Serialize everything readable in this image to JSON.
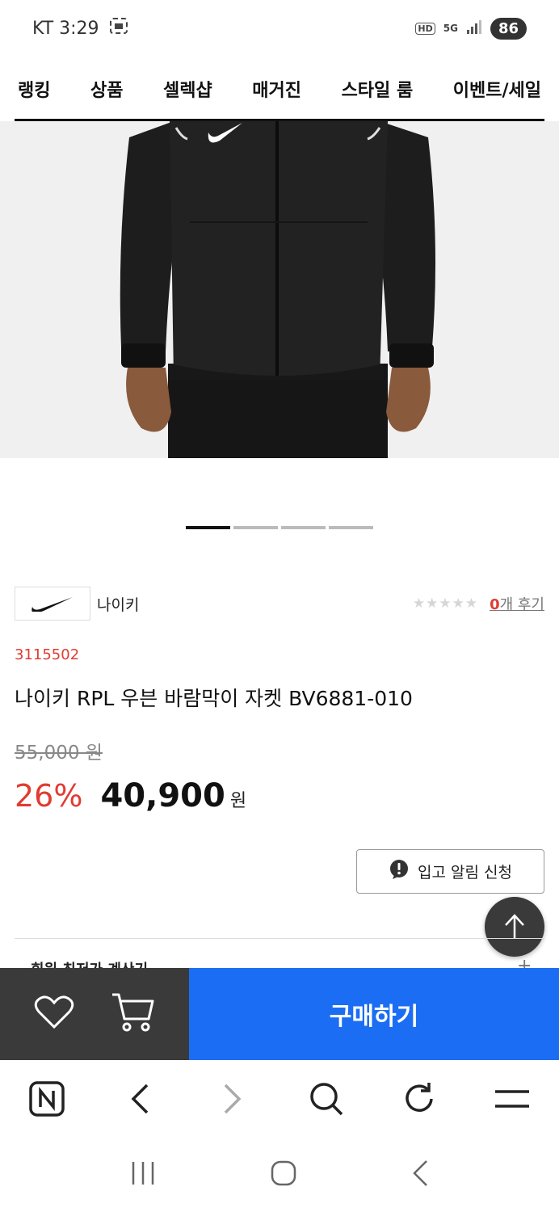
{
  "status_bar": {
    "carrier_time": "KT 3:29",
    "hd": "HD",
    "network": "5G",
    "battery": "86"
  },
  "nav": {
    "items": [
      "랭킹",
      "상품",
      "셀렉샵",
      "매거진",
      "스타일 룸",
      "이벤트/세일"
    ]
  },
  "carousel": {
    "total": 4,
    "active": 1
  },
  "brand": {
    "name": "나이키"
  },
  "review": {
    "stars": "★★★★★",
    "count": "0",
    "suffix": "개 후기"
  },
  "product": {
    "code": "3115502",
    "name": "나이키 RPL 우븐 바람막이 자켓 BV6881-010",
    "original_price": "55,000 원",
    "discount": "26%",
    "sale_price": "40,900",
    "currency": "원"
  },
  "restock": {
    "label": "입고 알림 신청"
  },
  "peek": {
    "text": "회원 최저가 계산기",
    "plus": "+"
  },
  "buy": {
    "label": "구매하기"
  },
  "colors": {
    "accent": "#1b6ef3",
    "sale": "#e03c31",
    "dark": "#3a3a3a"
  }
}
